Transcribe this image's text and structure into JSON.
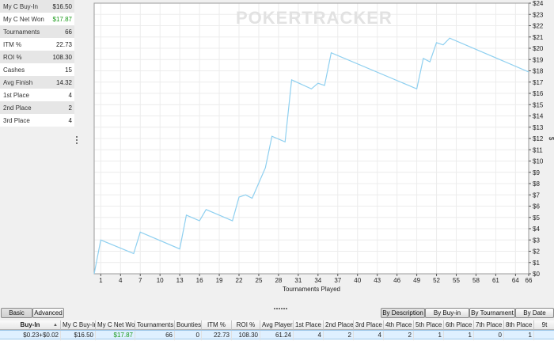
{
  "stats": [
    {
      "label": "My C Buy-In",
      "value": "$16.50",
      "color": "#222222"
    },
    {
      "label": "My C Net Won",
      "value": "$17.87",
      "color": "#1a9a1a"
    },
    {
      "label": "Tournaments",
      "value": "66",
      "color": "#222222"
    },
    {
      "label": "ITM %",
      "value": "22.73",
      "color": "#222222"
    },
    {
      "label": "ROI %",
      "value": "108.30",
      "color": "#222222"
    },
    {
      "label": "Cashes",
      "value": "15",
      "color": "#222222"
    },
    {
      "label": "Avg Finish",
      "value": "14.32",
      "color": "#222222"
    },
    {
      "label": "1st Place",
      "value": "4",
      "color": "#222222"
    },
    {
      "label": "2nd Place",
      "value": "2",
      "color": "#222222"
    },
    {
      "label": "3rd Place",
      "value": "4",
      "color": "#222222"
    }
  ],
  "watermark": "POKERTRACKER",
  "chart_data": {
    "type": "line",
    "xlabel": "Tournaments Played",
    "ylabel": "$",
    "xlim": [
      0,
      66
    ],
    "ylim": [
      0,
      24
    ],
    "x_ticks": [
      1,
      4,
      7,
      10,
      13,
      16,
      19,
      22,
      25,
      28,
      31,
      34,
      37,
      40,
      43,
      46,
      49,
      52,
      55,
      58,
      61,
      64,
      66
    ],
    "y_ticks": [
      0,
      1,
      2,
      3,
      4,
      5,
      6,
      7,
      8,
      9,
      10,
      11,
      12,
      13,
      14,
      15,
      16,
      17,
      18,
      19,
      20,
      21,
      22,
      23,
      24
    ],
    "y_tick_prefix": "$",
    "grid": true,
    "line_color": "#8fd0f0",
    "series": [
      {
        "x": [
          0,
          1,
          6,
          7,
          13,
          14,
          16,
          17,
          21,
          22,
          23,
          24,
          26,
          27,
          29,
          30,
          33,
          34,
          35,
          36,
          49,
          50,
          51,
          52,
          53,
          54,
          66
        ],
        "y": [
          0,
          3.0,
          1.8,
          3.7,
          2.2,
          5.2,
          4.7,
          5.7,
          4.7,
          6.8,
          7.0,
          6.7,
          9.4,
          12.2,
          11.7,
          17.2,
          16.4,
          16.9,
          16.7,
          19.6,
          16.4,
          19.1,
          18.8,
          20.5,
          20.3,
          20.9,
          17.9
        ]
      }
    ]
  },
  "toolbar": {
    "basic": "Basic",
    "advanced": "Advanced",
    "by_description": "By Description",
    "by_buyin": "By Buy-in",
    "by_tournament": "By Tournament",
    "by_date": "By Date"
  },
  "table": {
    "columns": [
      "Buy-In",
      "My C Buy-In",
      "My C Net Won",
      "Tournaments",
      "Bounties",
      "ITM %",
      "ROI %",
      "Avg Players",
      "1st Place",
      "2nd Place",
      "3rd Place",
      "4th Place",
      "5th Place",
      "6th Place",
      "7th Place",
      "8th Place",
      "9t"
    ],
    "sort_icon": "▲",
    "rows": [
      [
        "$0.23+$0.02",
        "$16.50",
        "$17.87",
        "66",
        "0",
        "22.73",
        "108.30",
        "61.24",
        "4",
        "2",
        "4",
        "2",
        "1",
        "1",
        "0",
        "1",
        ""
      ]
    ],
    "net_won_color": "#1a9a1a"
  }
}
